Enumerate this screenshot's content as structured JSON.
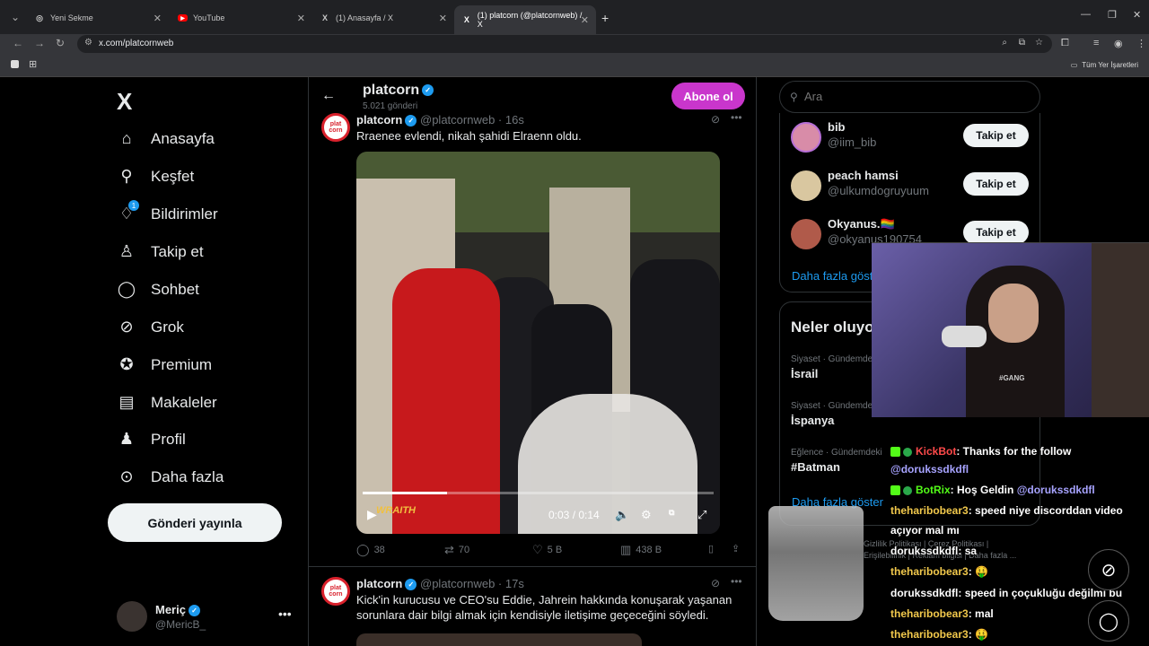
{
  "browser": {
    "tabs": [
      {
        "title": "Yeni Sekme"
      },
      {
        "title": "YouTube"
      },
      {
        "title": "(1) Anasayfa / X"
      },
      {
        "title": "(1) platcorn (@platcornweb) / X"
      }
    ],
    "url": "x.com/platcornweb",
    "bookmarks_label": "Tüm Yer İşaretleri"
  },
  "nav": {
    "logo": "X",
    "items": [
      {
        "label": "Anasayfa",
        "icon": "home-icon"
      },
      {
        "label": "Keşfet",
        "icon": "search-icon"
      },
      {
        "label": "Bildirimler",
        "icon": "bell-icon",
        "badge": "1"
      },
      {
        "label": "Takip et",
        "icon": "add-user-icon"
      },
      {
        "label": "Sohbet",
        "icon": "chat-icon"
      },
      {
        "label": "Grok",
        "icon": "grok-icon"
      },
      {
        "label": "Premium",
        "icon": "premium-icon"
      },
      {
        "label": "Makaleler",
        "icon": "article-icon"
      },
      {
        "label": "Profil",
        "icon": "profile-icon"
      },
      {
        "label": "Daha fazla",
        "icon": "more-icon"
      }
    ],
    "post_button": "Gönderi yayınla",
    "account": {
      "name": "Meriç",
      "handle": "@MericB_"
    }
  },
  "profile_header": {
    "name": "platcorn",
    "post_count": "5.021 gönderi",
    "subscribe_label": "Abone ol"
  },
  "tweets": [
    {
      "name": "platcorn",
      "handle": "@platcornweb",
      "time": "· 16s",
      "text": "Rraenee evlendi, nikah şahidi Elraenn oldu.",
      "video": {
        "time": "0:03 / 0:14",
        "progress": 0.24,
        "overlay_text": "WRAITH"
      },
      "stats": {
        "replies": "38",
        "reposts": "70",
        "likes": "5 B",
        "views": "438 B"
      }
    },
    {
      "name": "platcorn",
      "handle": "@platcornweb",
      "time": "· 17s",
      "text": "Kick'in kurucusu ve CEO'su Eddie, Jahrein hakkında konuşarak yaşanan sorunlara dair bilgi almak için kendisiyle iletişime geçeceğini söyledi."
    }
  ],
  "right": {
    "search_placeholder": "Ara",
    "who_to_follow": [
      {
        "name": "bib",
        "handle": "@iim_bib",
        "follow": "Takip et",
        "color": "#d88ca8"
      },
      {
        "name": "peach hamsi",
        "handle": "@ulkumdogruyuum",
        "follow": "Takip et",
        "color": "#d9c7a0"
      },
      {
        "name": "Okyanus.🏳️‍🌈",
        "handle": "@okyanus190754",
        "follow": "Takip et",
        "color": "#b05a4a"
      }
    ],
    "more_label": "Daha fazla göster",
    "trends_title": "Neler oluyor",
    "trends": [
      {
        "category": "Siyaset · Gündemde",
        "name": "İsrail"
      },
      {
        "category": "Siyaset · Gündemde",
        "name": "İspanya"
      },
      {
        "category": "Eğlence · Gündemdeki",
        "name": "#Batman"
      }
    ],
    "trends_more": "Daha fazla göster",
    "footer": [
      "Gizlilik Politikası",
      "Çerez Politikası",
      "Erişilebilirlik",
      "Reklam bilgisi",
      "Daha fazla ..."
    ]
  },
  "stream": {
    "shirt_text": "#GANG",
    "chat": [
      {
        "user": "KickBot",
        "user_color": "#ff4a4a",
        "msg": ": Thanks for the follow",
        "badge": true
      },
      {
        "user": "",
        "user_color": "#a7a3ff",
        "msg": "@dorukssdkdfl",
        "badge": false,
        "mention": true
      },
      {
        "user": "BotRix",
        "user_color": "#53fc18",
        "msg": ": Hoş Geldin ",
        "mention_msg": "@dorukssdkdfl",
        "badge": true
      },
      {
        "user": "theharibobear3",
        "user_color": "#f2c94c",
        "msg": ": speed niye discorddan video",
        "badge": false
      },
      {
        "user": "",
        "user_color": "#fff",
        "msg": "açıyor mal mı",
        "badge": false
      },
      {
        "user": "dorukssdkdfl",
        "user_color": "#e7e9ea",
        "msg": ": sa",
        "badge": false
      },
      {
        "user": "theharibobear3",
        "user_color": "#f2c94c",
        "msg": ": 🤑",
        "badge": false
      },
      {
        "user": "dorukssdkdfl",
        "user_color": "#e7e9ea",
        "msg": ": speed in çoçukluğu değilmi bu",
        "badge": false
      },
      {
        "user": "theharibobear3",
        "user_color": "#f2c94c",
        "msg": ": mal",
        "badge": false
      },
      {
        "user": "theharibobear3",
        "user_color": "#f2c94c",
        "msg": ": 🤑",
        "badge": false
      }
    ]
  }
}
